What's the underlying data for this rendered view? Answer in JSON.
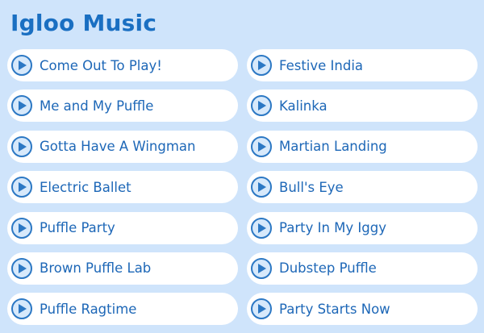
{
  "title": "Igloo Music",
  "colors": {
    "background": "#cfe4fb",
    "title": "#1a6fc2",
    "button_bg": "#ffffff",
    "text": "#1d67b7",
    "icon": "#2c78c4"
  },
  "icon": "play-icon",
  "songs_left": [
    {
      "label": "Come Out To Play!"
    },
    {
      "label": "Me and My Puffle"
    },
    {
      "label": "Gotta Have A Wingman"
    },
    {
      "label": "Electric Ballet"
    },
    {
      "label": "Puffle Party"
    },
    {
      "label": "Brown Puffle Lab"
    },
    {
      "label": "Puffle Ragtime"
    }
  ],
  "songs_right": [
    {
      "label": "Festive India"
    },
    {
      "label": "Kalinka"
    },
    {
      "label": "Martian Landing"
    },
    {
      "label": "Bull's Eye"
    },
    {
      "label": "Party In My Iggy"
    },
    {
      "label": "Dubstep Puffle"
    },
    {
      "label": "Party Starts Now"
    }
  ]
}
